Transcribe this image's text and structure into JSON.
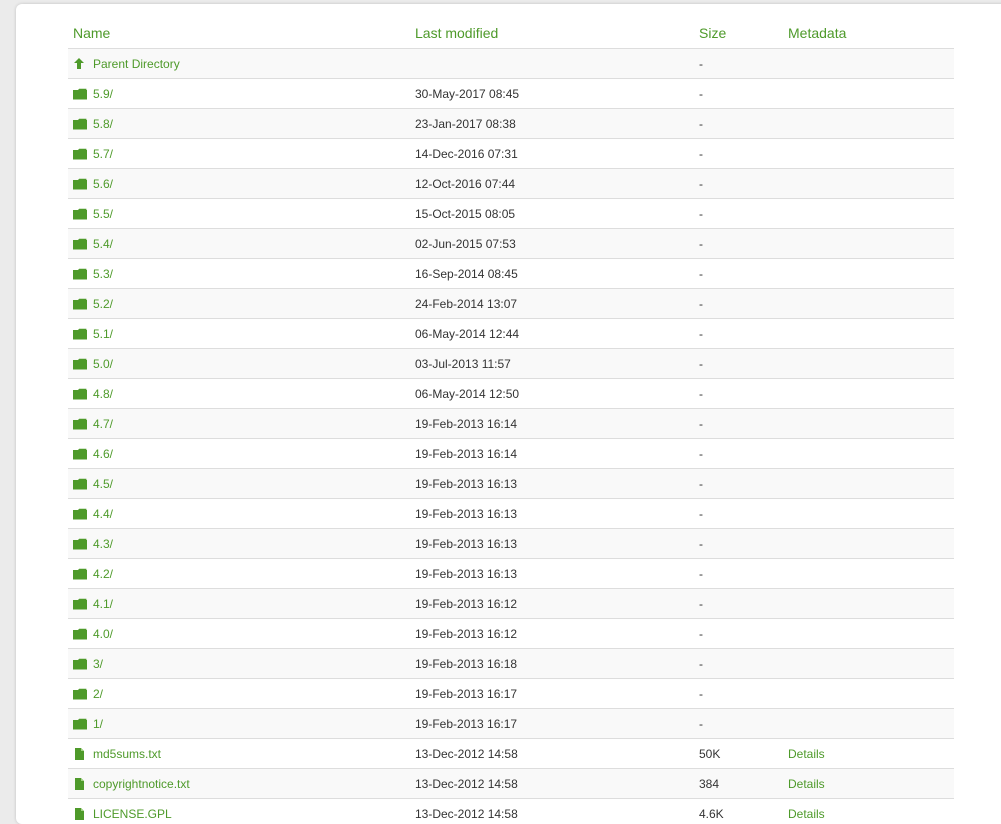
{
  "columns": {
    "name": "Name",
    "last_modified": "Last modified",
    "size": "Size",
    "metadata": "Metadata"
  },
  "colors": {
    "accent": "#4e9a2a"
  },
  "rows": [
    {
      "icon": "arrow-up-icon",
      "name": "Parent Directory",
      "date": "",
      "size": "-",
      "meta": ""
    },
    {
      "icon": "folder-icon",
      "name": "5.9/",
      "date": "30-May-2017 08:45",
      "size": "-",
      "meta": ""
    },
    {
      "icon": "folder-icon",
      "name": "5.8/",
      "date": "23-Jan-2017 08:38",
      "size": "-",
      "meta": ""
    },
    {
      "icon": "folder-icon",
      "name": "5.7/",
      "date": "14-Dec-2016 07:31",
      "size": "-",
      "meta": ""
    },
    {
      "icon": "folder-icon",
      "name": "5.6/",
      "date": "12-Oct-2016 07:44",
      "size": "-",
      "meta": ""
    },
    {
      "icon": "folder-icon",
      "name": "5.5/",
      "date": "15-Oct-2015 08:05",
      "size": "-",
      "meta": ""
    },
    {
      "icon": "folder-icon",
      "name": "5.4/",
      "date": "02-Jun-2015 07:53",
      "size": "-",
      "meta": ""
    },
    {
      "icon": "folder-icon",
      "name": "5.3/",
      "date": "16-Sep-2014 08:45",
      "size": "-",
      "meta": ""
    },
    {
      "icon": "folder-icon",
      "name": "5.2/",
      "date": "24-Feb-2014 13:07",
      "size": "-",
      "meta": ""
    },
    {
      "icon": "folder-icon",
      "name": "5.1/",
      "date": "06-May-2014 12:44",
      "size": "-",
      "meta": ""
    },
    {
      "icon": "folder-icon",
      "name": "5.0/",
      "date": "03-Jul-2013 11:57",
      "size": "-",
      "meta": ""
    },
    {
      "icon": "folder-icon",
      "name": "4.8/",
      "date": "06-May-2014 12:50",
      "size": "-",
      "meta": ""
    },
    {
      "icon": "folder-icon",
      "name": "4.7/",
      "date": "19-Feb-2013 16:14",
      "size": "-",
      "meta": ""
    },
    {
      "icon": "folder-icon",
      "name": "4.6/",
      "date": "19-Feb-2013 16:14",
      "size": "-",
      "meta": ""
    },
    {
      "icon": "folder-icon",
      "name": "4.5/",
      "date": "19-Feb-2013 16:13",
      "size": "-",
      "meta": ""
    },
    {
      "icon": "folder-icon",
      "name": "4.4/",
      "date": "19-Feb-2013 16:13",
      "size": "-",
      "meta": ""
    },
    {
      "icon": "folder-icon",
      "name": "4.3/",
      "date": "19-Feb-2013 16:13",
      "size": "-",
      "meta": ""
    },
    {
      "icon": "folder-icon",
      "name": "4.2/",
      "date": "19-Feb-2013 16:13",
      "size": "-",
      "meta": ""
    },
    {
      "icon": "folder-icon",
      "name": "4.1/",
      "date": "19-Feb-2013 16:12",
      "size": "-",
      "meta": ""
    },
    {
      "icon": "folder-icon",
      "name": "4.0/",
      "date": "19-Feb-2013 16:12",
      "size": "-",
      "meta": ""
    },
    {
      "icon": "folder-icon",
      "name": "3/",
      "date": "19-Feb-2013 16:18",
      "size": "-",
      "meta": ""
    },
    {
      "icon": "folder-icon",
      "name": "2/",
      "date": "19-Feb-2013 16:17",
      "size": "-",
      "meta": ""
    },
    {
      "icon": "folder-icon",
      "name": "1/",
      "date": "19-Feb-2013 16:17",
      "size": "-",
      "meta": ""
    },
    {
      "icon": "file-icon",
      "name": "md5sums.txt",
      "date": "13-Dec-2012 14:58",
      "size": "50K",
      "meta": "Details"
    },
    {
      "icon": "file-icon",
      "name": "copyrightnotice.txt",
      "date": "13-Dec-2012 14:58",
      "size": "384",
      "meta": "Details"
    },
    {
      "icon": "file-icon",
      "name": "LICENSE.GPL",
      "date": "13-Dec-2012 14:58",
      "size": "4.6K",
      "meta": "Details"
    }
  ]
}
